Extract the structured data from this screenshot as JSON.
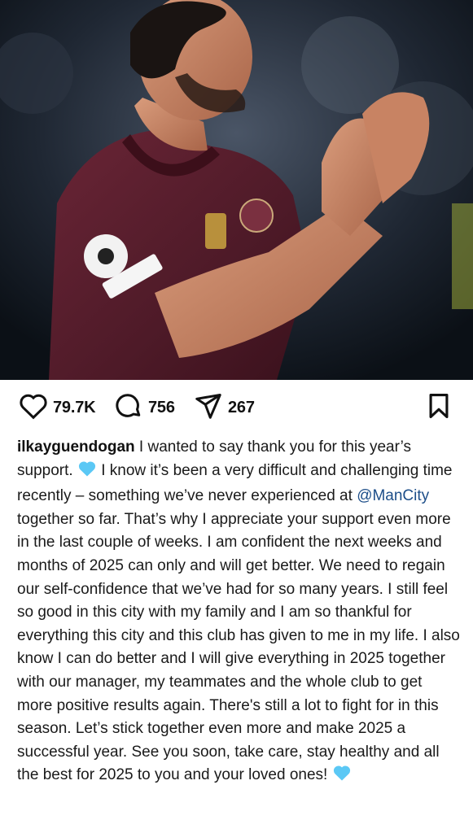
{
  "post": {
    "photo_alt": "player applauding",
    "stats": {
      "likes": "79.7K",
      "comments": "756",
      "shares": "267"
    },
    "caption": {
      "username": "ilkayguendogan",
      "part1": " I wanted to say thank you for this year’s support. ",
      "part2": " I know it’s been a very difficult and challenging time recently – something we’ve never experienced at ",
      "mention": "@ManCity",
      "part3": " together so far. That’s why I appreciate your support even more in the last couple of weeks. I am confident the next weeks and months of 2025 can only and will get better. We need to regain our self-confidence that we’ve had for so many years. I still feel so good in this city with my family and I am so thankful for everything this city and this club has given to me in my life. I also know I can do better and I will give everything in 2025 together with our manager, my teammates and the whole club to get more positive results again. There's still a lot to fight for in this season. Let’s stick together even more and make 2025 a successful year. See you soon, take care, stay healthy and all the best for 2025 to you and your loved ones! "
    },
    "colors": {
      "heart_emoji": "#5bc8f5",
      "mention": "#1d4e89",
      "jersey": "#5b1f2e"
    },
    "icons": [
      "heart-icon",
      "comment-icon",
      "share-icon",
      "bookmark-icon",
      "light-blue-heart-icon"
    ]
  }
}
